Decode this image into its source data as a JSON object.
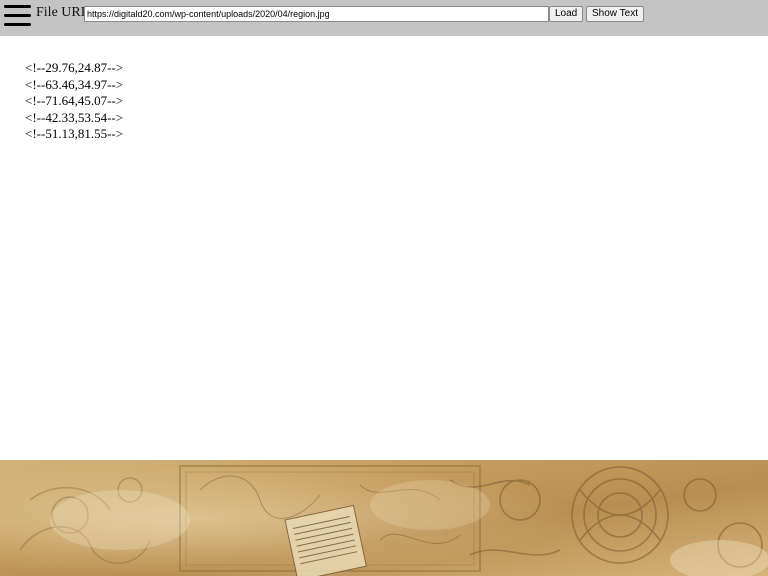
{
  "toolbar": {
    "menu_icon": "hamburger-menu-icon",
    "url_label": "File URL:",
    "url_value": "https://digitald20.com/wp-content/uploads/2020/04/region.jpg",
    "load_label": "Load",
    "show_text_label": "Show Text"
  },
  "content": {
    "lines": [
      "<!--29.76,24.87-->",
      "<!--63.46,34.97-->",
      "<!--71.64,45.07-->",
      "<!--42.33,53.54-->",
      "<!--51.13,81.55-->"
    ]
  },
  "footer": {
    "image_description": "decorative-manuscript-banner"
  }
}
